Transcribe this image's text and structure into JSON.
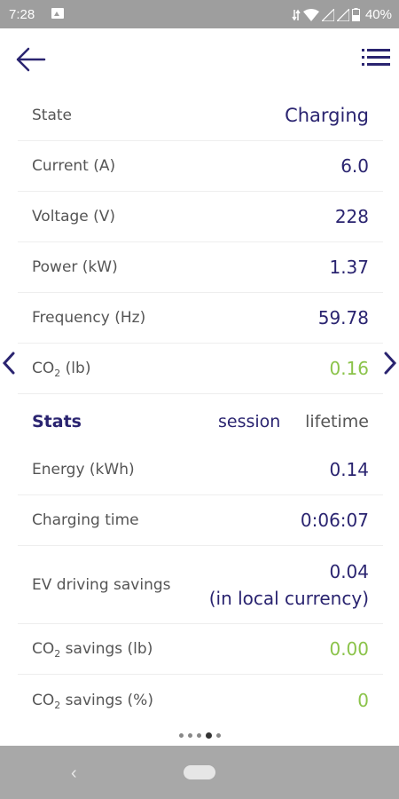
{
  "status_bar": {
    "time": "7:28",
    "battery": "40%"
  },
  "details": [
    {
      "label": "State",
      "value": "Charging",
      "color": "#2a2470"
    },
    {
      "label": "Current (A)",
      "value": "6.0",
      "color": "#2a2470"
    },
    {
      "label": "Voltage (V)",
      "value": "228",
      "color": "#2a2470"
    },
    {
      "label": "Power (kW)",
      "value": "1.37",
      "color": "#2a2470"
    },
    {
      "label": "Frequency (Hz)",
      "value": "59.78",
      "color": "#2a2470"
    },
    {
      "label_main": "CO",
      "label_sub": "2",
      "label_rest": " (lb)",
      "value": "0.16",
      "color": "#8bc34a"
    }
  ],
  "stats": {
    "title": "Stats",
    "session": "session",
    "lifetime": "lifetime",
    "rows": [
      {
        "label": "Energy (kWh)",
        "value": "0.14"
      },
      {
        "label": "Charging time",
        "value": "0:06:07"
      },
      {
        "label": "EV driving savings",
        "value_line1": "0.04",
        "value_line2": "(in local currency)"
      },
      {
        "label_main": "CO",
        "label_sub": "2",
        "label_rest": " savings (lb)",
        "value": "0.00"
      },
      {
        "label_main": "CO",
        "label_sub": "2",
        "label_rest": " savings (%)",
        "value": "0"
      }
    ]
  },
  "pager": {
    "count": 5,
    "active": 3
  }
}
